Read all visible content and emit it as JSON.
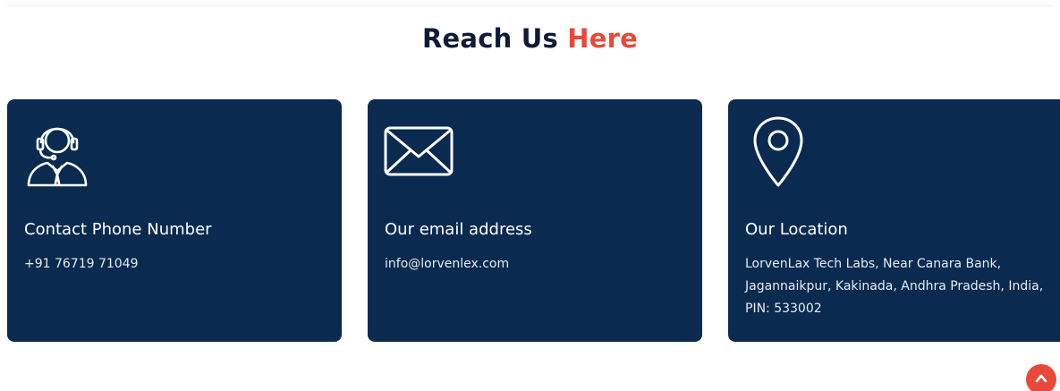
{
  "section": {
    "title_main": "Reach Us",
    "title_accent": "Here",
    "accent_color": "#e8493b",
    "card_color": "#0a2a4f"
  },
  "cards": [
    {
      "icon": "customer-support-icon",
      "title": "Contact Phone Number",
      "detail": "+91 76719 71049"
    },
    {
      "icon": "envelope-icon",
      "title": "Our email address",
      "detail": "info@lorvenlex.com"
    },
    {
      "icon": "location-pin-icon",
      "title": "Our Location",
      "detail": "LorvenLax Tech Labs, Near Canara Bank, Jagannaikpur, Kakinada, Andhra Pradesh, India, PIN: 533002"
    }
  ],
  "scroll_top": {
    "icon": "chevron-up-icon"
  }
}
